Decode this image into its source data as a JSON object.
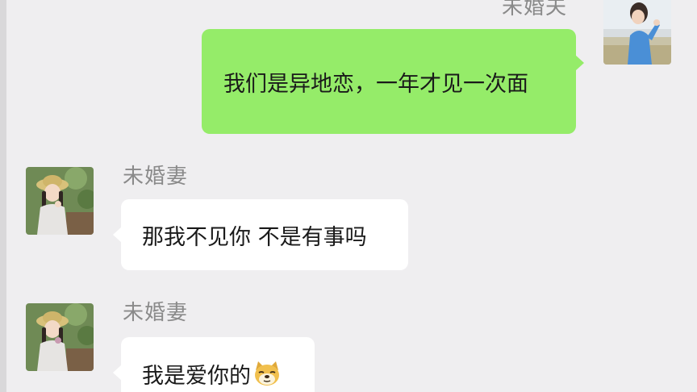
{
  "chat": {
    "messages": [
      {
        "sender_name": "未婚夫",
        "side": "right",
        "text": "我们是异地恋，一年才见一次面"
      },
      {
        "sender_name": "未婚妻",
        "side": "left",
        "text": "那我不见你 不是有事吗"
      },
      {
        "sender_name": "未婚妻",
        "side": "left",
        "text": "我是爱你的",
        "emoji": "doge-emoji"
      }
    ]
  },
  "colors": {
    "background": "#efeef0",
    "my_bubble": "#95ec69",
    "other_bubble": "#ffffff",
    "name_text": "#8a8a8a"
  }
}
